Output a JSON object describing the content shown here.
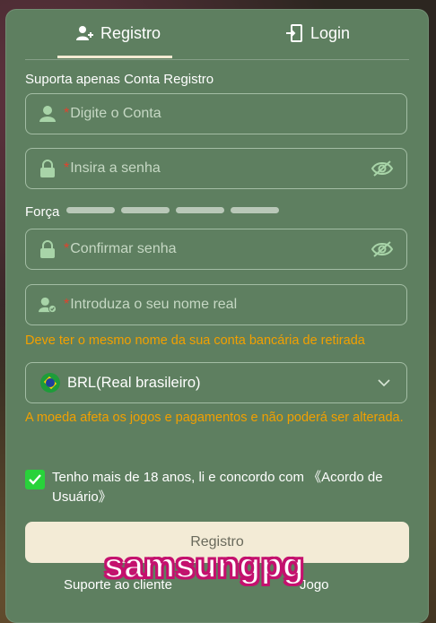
{
  "tabs": {
    "register": "Registro",
    "login": "Login"
  },
  "section_title": "Suporta apenas Conta Registro",
  "fields": {
    "account": {
      "required_mark": "*",
      "placeholder": "Digite o Conta"
    },
    "password": {
      "required_mark": "*",
      "placeholder": "Insira a senha"
    },
    "confirm": {
      "required_mark": "*",
      "placeholder": "Confirmar senha"
    },
    "real_name": {
      "required_mark": "*",
      "placeholder": "Introduza o seu nome real"
    }
  },
  "strength_label": "Força",
  "name_hint": "Deve ter o mesmo nome da sua conta bancária de retirada",
  "currency": {
    "selected": "BRL(Real brasileiro)"
  },
  "currency_hint": "A moeda afeta os jogos e pagamentos e não poderá ser alterada.",
  "agree_text": "Tenho mais de 18 anos, li e concordo com 《Acordo de Usuário》",
  "submit_label": "Registro",
  "footer": {
    "support": "Suporte ao cliente",
    "other": "Jogo"
  },
  "watermark": "samsungpg",
  "colors": {
    "card": "#5e7f60",
    "button": "#f3ebd6",
    "hint": "#f2a000",
    "required": "#e2422d",
    "checkbox": "#28d23a"
  }
}
